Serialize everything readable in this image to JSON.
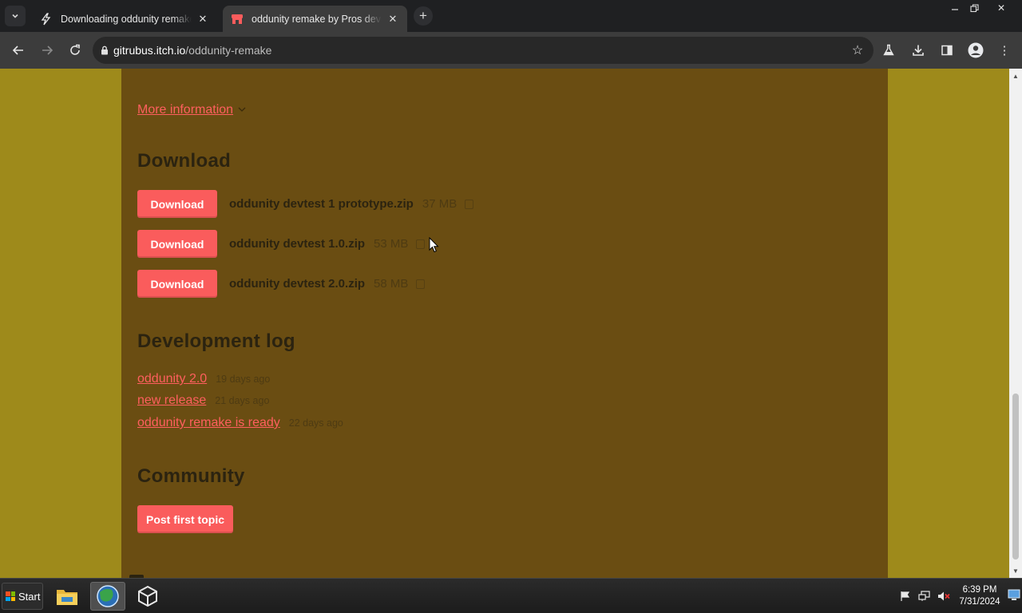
{
  "browser": {
    "tabs": [
      {
        "title": "Downloading oddunity remake",
        "active": false
      },
      {
        "title": "oddunity remake by Pros developer",
        "active": true
      }
    ],
    "address": {
      "host": "gitrubus.itch.io",
      "path": "/oddunity-remake"
    }
  },
  "page": {
    "more_info": "More information",
    "download_title": "Download",
    "downloads": [
      {
        "button": "Download",
        "name": "oddunity devtest 1 prototype.zip",
        "size": "37 MB"
      },
      {
        "button": "Download",
        "name": "oddunity devtest 1.0.zip",
        "size": "53 MB"
      },
      {
        "button": "Download",
        "name": "oddunity devtest 2.0.zip",
        "size": "58 MB"
      }
    ],
    "devlog_title": "Development log",
    "devlog": [
      {
        "title": "oddunity 2.0",
        "date": "19 days ago"
      },
      {
        "title": "new release",
        "date": "21 days ago"
      },
      {
        "title": "oddunity remake is ready",
        "date": "22 days ago"
      }
    ],
    "community_title": "Community",
    "post_button": "Post first topic"
  },
  "taskbar": {
    "start_label": "Start",
    "time": "6:39 PM",
    "date": "7/31/2024"
  },
  "colors": {
    "page_bg": "#9e8a1b",
    "content_bg": "#6a4d12",
    "accent": "#fa5c5c",
    "link": "#ff5f5f",
    "heading": "#2b2310"
  }
}
